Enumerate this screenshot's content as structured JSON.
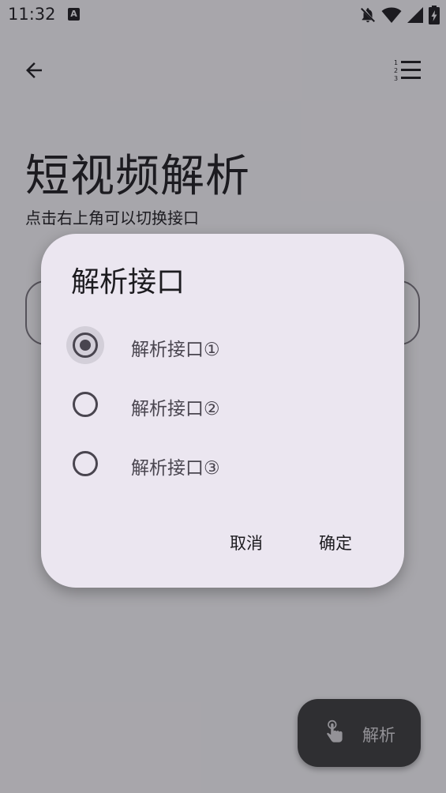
{
  "status_bar": {
    "time": "11:32",
    "notification_icon_label": "A",
    "icons": [
      "a-notification-icon",
      "bell-off-icon",
      "wifi-icon",
      "signal-icon",
      "battery-charging-icon"
    ]
  },
  "app_bar": {
    "back_icon": "arrow-back-icon",
    "menu_icon": "format-list-numbered-icon"
  },
  "page": {
    "title": "短视频解析",
    "subtitle": "点击右上角可以切换接口"
  },
  "fab": {
    "label": "解析",
    "icon": "touch-app-icon"
  },
  "dialog": {
    "title": "解析接口",
    "options": [
      {
        "label": "解析接口①",
        "selected": true
      },
      {
        "label": "解析接口②",
        "selected": false
      },
      {
        "label": "解析接口③",
        "selected": false
      }
    ],
    "cancel_label": "取消",
    "confirm_label": "确定"
  },
  "colors": {
    "background": "#fcfbff",
    "dialog_surface": "#ebe6f0",
    "on_surface": "#1c1b1f",
    "on_surface_variant": "#49454f",
    "fab": "#000000"
  }
}
